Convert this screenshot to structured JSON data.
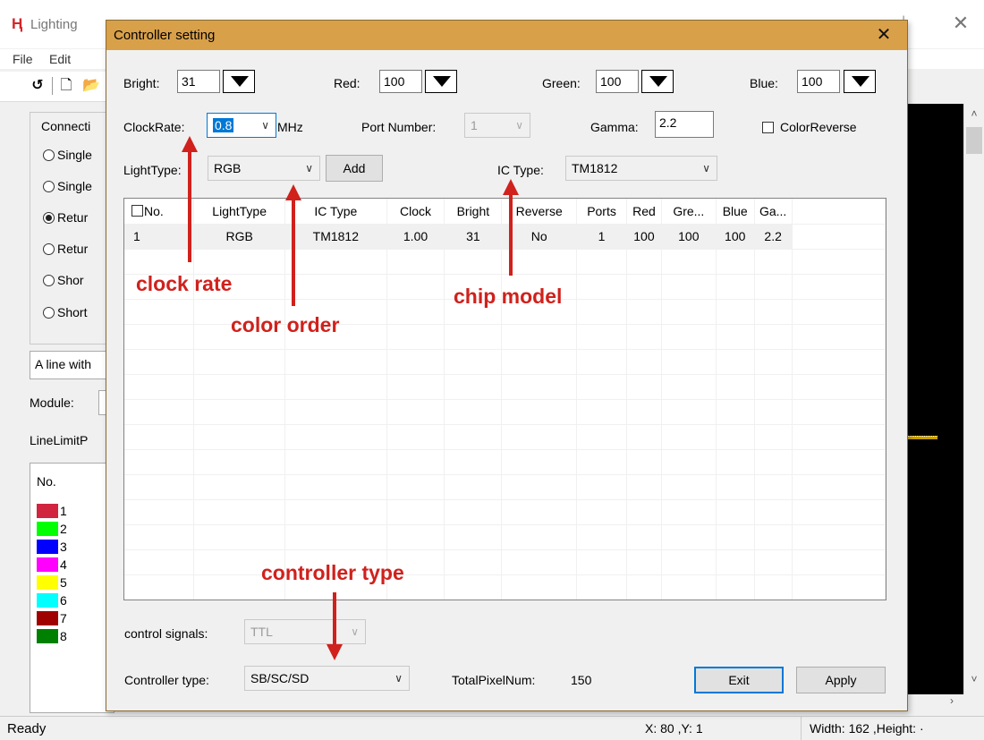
{
  "main_window": {
    "title": "Lighting",
    "menu": [
      "File",
      "Edit"
    ],
    "connection_group_title": "Connecti",
    "connection_options": [
      {
        "label": "Single",
        "selected": false
      },
      {
        "label": "Single",
        "selected": false
      },
      {
        "label": "Retur",
        "selected": true
      },
      {
        "label": "Retur",
        "selected": false
      },
      {
        "label": "Shor",
        "selected": false
      },
      {
        "label": "Short",
        "selected": false
      }
    ],
    "line_combo": "A line with",
    "module_label": "Module:",
    "line_limit_label": "LineLimitP",
    "color_list_header": "No.",
    "color_list": [
      {
        "no": "1",
        "color": "#d1243f"
      },
      {
        "no": "2",
        "color": "#00ff00"
      },
      {
        "no": "3",
        "color": "#0000ff"
      },
      {
        "no": "4",
        "color": "#ff00ff"
      },
      {
        "no": "5",
        "color": "#ffff00"
      },
      {
        "no": "6",
        "color": "#00ffff"
      },
      {
        "no": "7",
        "color": "#a00000"
      },
      {
        "no": "8",
        "color": "#008000"
      }
    ],
    "status_ready": "Ready",
    "status_xy": "X: 80 ,Y: 1",
    "status_size": "Width: 162 ,Height: ·"
  },
  "dialog": {
    "title": "Controller setting",
    "bright_label": "Bright:",
    "bright_value": "31",
    "red_label": "Red:",
    "red_value": "100",
    "green_label": "Green:",
    "green_value": "100",
    "blue_label": "Blue:",
    "blue_value": "100",
    "clockrate_label": "ClockRate:",
    "clockrate_value": "0.8",
    "clockrate_unit": "MHz",
    "port_number_label": "Port Number:",
    "port_number_value": "1",
    "gamma_label": "Gamma:",
    "gamma_value": "2.2",
    "color_reverse_label": "ColorReverse",
    "color_reverse_checked": false,
    "lighttype_label": "LightType:",
    "lighttype_value": "RGB",
    "add_button": "Add",
    "ictype_label": "IC Type:",
    "ictype_value": "TM1812",
    "table": {
      "columns": [
        "No.",
        "LightType",
        "IC Type",
        "Clock",
        "Bright",
        "Reverse",
        "Ports",
        "Red",
        "Gre...",
        "Blue",
        "Ga..."
      ],
      "rows": [
        [
          "1",
          "RGB",
          "TM1812",
          "1.00",
          "31",
          "No",
          "1",
          "100",
          "100",
          "100",
          "2.2"
        ]
      ]
    },
    "control_signals_label": "control signals:",
    "control_signals_value": "TTL",
    "controller_type_label": "Controller type:",
    "controller_type_value": "SB/SC/SD",
    "total_pixel_label": "TotalPixelNum:",
    "total_pixel_value": "150",
    "exit_button": "Exit",
    "apply_button": "Apply"
  },
  "annotations": {
    "clock_rate": "clock rate",
    "color_order": "color order",
    "chip_model": "chip model",
    "controller_type": "controller type"
  },
  "colors": {
    "dialog_titlebar": "#d9a04a",
    "annotation": "#d0211c",
    "canvas": "#000000"
  }
}
